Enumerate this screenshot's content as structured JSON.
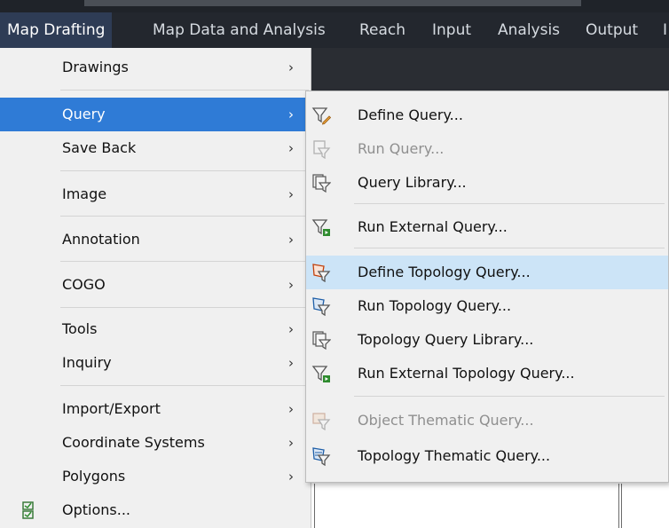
{
  "menubar": {
    "tabs": [
      {
        "label": "Map Drafting",
        "active": true
      },
      {
        "label": "Map Data and Analysis"
      },
      {
        "label": "Reach"
      },
      {
        "label": "Input"
      },
      {
        "label": "Analysis"
      },
      {
        "label": "Output"
      },
      {
        "label": "I"
      }
    ]
  },
  "main_menu": {
    "items": [
      {
        "label": "Drawings",
        "chevron": "›"
      },
      {
        "label": "Query",
        "chevron": "›",
        "active": true
      },
      {
        "label": "Save Back",
        "chevron": "›"
      },
      {
        "label": "Image",
        "chevron": "›"
      },
      {
        "label": "Annotation",
        "chevron": "›"
      },
      {
        "label": "COGO",
        "chevron": "›"
      },
      {
        "label": "Tools",
        "chevron": "›"
      },
      {
        "label": "Inquiry",
        "chevron": "›"
      },
      {
        "label": "Import/Export",
        "chevron": "›"
      },
      {
        "label": "Coordinate Systems",
        "chevron": "›"
      },
      {
        "label": "Polygons",
        "chevron": "›"
      },
      {
        "label": "Options...",
        "icon": "options-icon"
      }
    ]
  },
  "query_submenu": {
    "items": [
      {
        "label": "Define Query...",
        "icon": "define-query-icon"
      },
      {
        "label": "Run Query...",
        "icon": "run-query-icon",
        "disabled": true
      },
      {
        "label": "Query Library...",
        "icon": "query-library-icon"
      },
      {
        "label": "Run External Query...",
        "icon": "run-external-query-icon"
      },
      {
        "label": "Define Topology Query...",
        "icon": "define-topology-query-icon",
        "active": true
      },
      {
        "label": "Run Topology Query...",
        "icon": "run-topology-query-icon"
      },
      {
        "label": "Topology Query Library...",
        "icon": "topology-query-library-icon"
      },
      {
        "label": "Run External Topology Query...",
        "icon": "run-external-topology-query-icon"
      },
      {
        "label": "Object Thematic Query...",
        "icon": "object-thematic-query-icon",
        "disabled": true
      },
      {
        "label": "Topology Thematic Query...",
        "icon": "topology-thematic-query-icon"
      }
    ]
  },
  "colors": {
    "menubar_bg": "#23272e",
    "active_tab_bg": "#2e3c55",
    "menu_bg": "#f0f0f0",
    "menu_highlight": "#2f7bd6",
    "submenu_highlight": "#cce4f7",
    "disabled_text": "#8f8f8f"
  }
}
